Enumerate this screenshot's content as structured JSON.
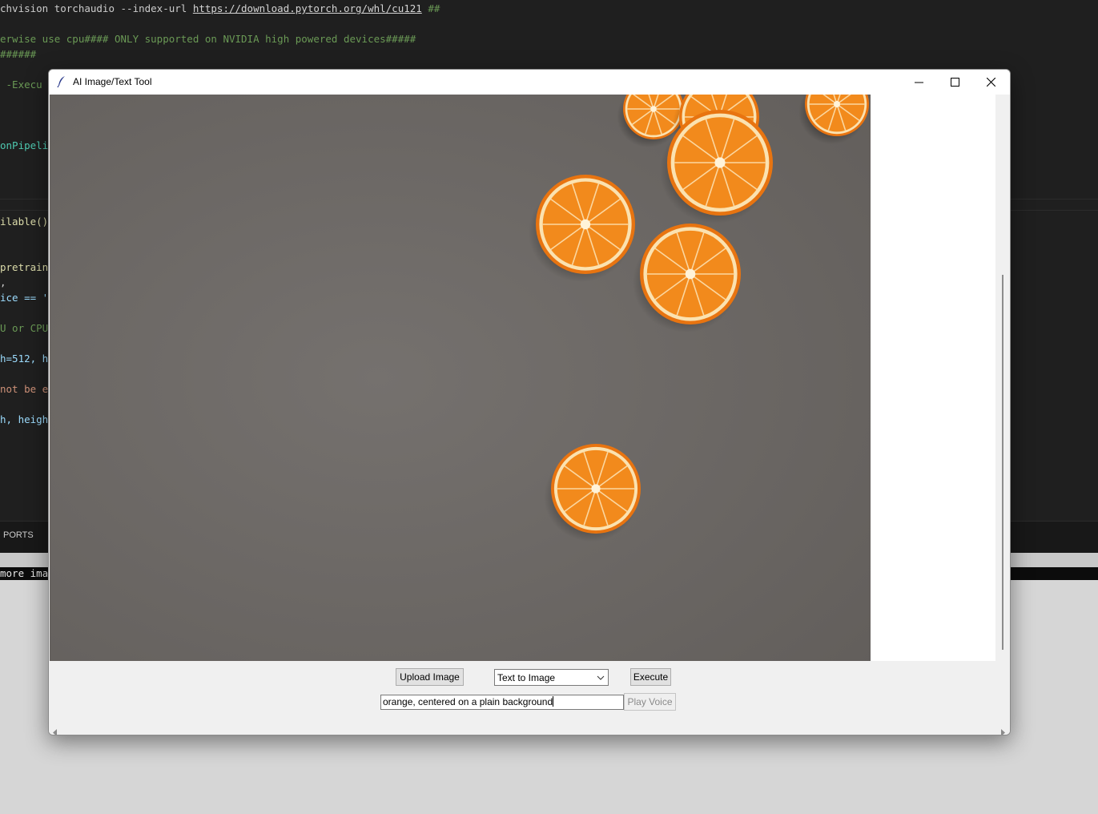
{
  "editor": {
    "lines": [
      {
        "parts": [
          {
            "t": "chvision torchaudio --index-url ",
            "c": "c-white"
          },
          {
            "t": "https://download.pytorch.org/whl/cu121",
            "c": "c-link"
          },
          {
            "t": " ##",
            "c": "c-green"
          }
        ]
      },
      {
        "parts": [
          {
            "t": "erwise use cpu#### ONLY supported on NVIDIA high powered devices#####",
            "c": "c-green"
          }
        ]
      },
      {
        "parts": [
          {
            "t": "######",
            "c": "c-green"
          }
        ]
      },
      {
        "parts": [
          {
            "t": " -Execu",
            "c": "c-green"
          }
        ]
      },
      {
        "parts": [
          {
            "t": "onPipelin",
            "c": "c-teal"
          }
        ]
      },
      {
        "parts": [
          {
            "t": "ilable()",
            "c": "c-yellow"
          }
        ]
      },
      {
        "parts": [
          {
            "t": "pretrain",
            "c": "c-yellow"
          }
        ]
      },
      {
        "parts": [
          {
            "t": ",",
            "c": "c-white"
          }
        ]
      },
      {
        "parts": [
          {
            "t": "ice == '",
            "c": "c-light"
          }
        ]
      },
      {
        "parts": [
          {
            "t": "U or CPU",
            "c": "c-green"
          }
        ]
      },
      {
        "parts": [
          {
            "t": "h=512, h",
            "c": "c-light"
          }
        ]
      },
      {
        "parts": [
          {
            "t": "not be e",
            "c": "c-orange"
          }
        ]
      },
      {
        "parts": [
          {
            "t": "h, heigh",
            "c": "c-light"
          }
        ]
      }
    ],
    "panel_tab": "PORTS",
    "terminal_text": "more imag"
  },
  "window": {
    "title": "AI Image/Text Tool",
    "upload_label": "Upload Image",
    "mode_value": "Text to Image",
    "execute_label": "Execute",
    "prompt_value": "orange, centered on a plain background",
    "play_label": "Play Voice",
    "colors": {
      "background": "#6f6b68",
      "orange": "#f28a1c",
      "pith": "#fbe2b0"
    }
  }
}
